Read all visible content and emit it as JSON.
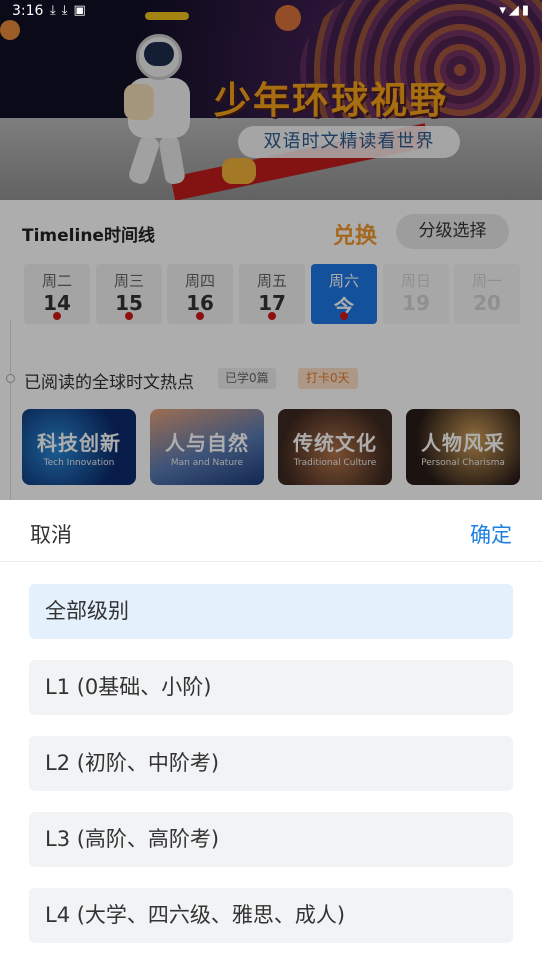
{
  "status_bar": {
    "time": "3:16",
    "left_icons": [
      "download-icon",
      "download-icon",
      "app-icon"
    ],
    "right_icons": [
      "wifi-icon",
      "signal-icon",
      "battery-icon"
    ]
  },
  "banner": {
    "title": "少年环球视野",
    "subtitle": "双语时文精读看世界"
  },
  "header": {
    "timeline_title": "Timeline时间线",
    "redeem_label": "兑换",
    "level_select_label": "分级选择"
  },
  "days": [
    {
      "weekday": "周二",
      "date": "14",
      "has_dot": true,
      "state": "normal"
    },
    {
      "weekday": "周三",
      "date": "15",
      "has_dot": true,
      "state": "normal"
    },
    {
      "weekday": "周四",
      "date": "16",
      "has_dot": true,
      "state": "normal"
    },
    {
      "weekday": "周五",
      "date": "17",
      "has_dot": true,
      "state": "normal"
    },
    {
      "weekday": "周六",
      "date": "今",
      "has_dot": true,
      "state": "active"
    },
    {
      "weekday": "周日",
      "date": "19",
      "has_dot": false,
      "state": "future"
    },
    {
      "weekday": "周一",
      "date": "20",
      "has_dot": false,
      "state": "future"
    }
  ],
  "reading": {
    "label": "已阅读的全球时文热点",
    "learned_badge": "已学0篇",
    "checkin_badge": "打卡0天"
  },
  "categories": [
    {
      "cn": "科技创新",
      "en": "Tech Innovation"
    },
    {
      "cn": "人与自然",
      "en": "Man and Nature"
    },
    {
      "cn": "传统文化",
      "en": "Traditional Culture"
    },
    {
      "cn": "人物风采",
      "en": "Personal Charisma"
    }
  ],
  "sheet": {
    "cancel_label": "取消",
    "confirm_label": "确定",
    "options": [
      {
        "label": "全部级别",
        "selected": true
      },
      {
        "label": "L1  (0基础、小阶)",
        "selected": false
      },
      {
        "label": "L2  (初阶、中阶考)",
        "selected": false
      },
      {
        "label": "L3  (高阶、高阶考)",
        "selected": false
      },
      {
        "label": "L4  (大学、四六级、雅思、成人)",
        "selected": false
      }
    ]
  },
  "colors": {
    "accent_blue": "#1e78e6",
    "confirm_blue": "#1e7fe3",
    "redeem_orange": "#f29a2e",
    "dot_red": "#d21a1a",
    "selected_option_bg": "#e4f0fc"
  }
}
